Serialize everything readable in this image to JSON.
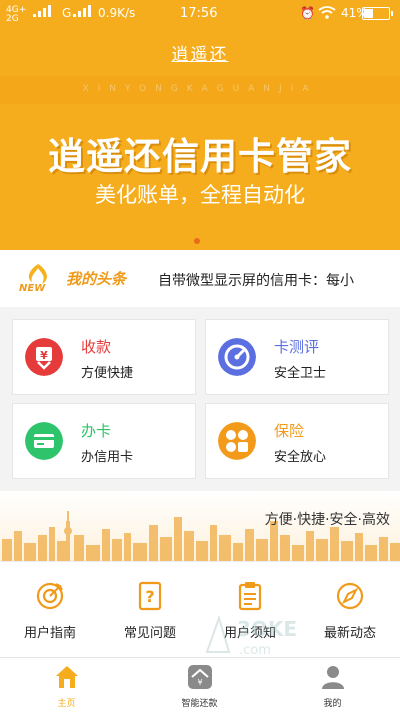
{
  "status_bar": {
    "network_type_top": "4G+",
    "network_type_bottom": "2G",
    "network_label": "G",
    "speed": "0.9K/s",
    "time": "17:56",
    "battery": "41%"
  },
  "header": {
    "title": "逍遥还"
  },
  "banner": {
    "pinyin": "XINYONGKAGUANJIA",
    "headline": "逍遥还信用卡管家",
    "subline": "美化账单，全程自动化"
  },
  "news": {
    "badge": "NEW",
    "tag": "我的头条",
    "ticker": "自带微型显示屏的信用卡：每小"
  },
  "tiles": [
    {
      "title": "收款",
      "desc": "方便快捷",
      "color": "#e53b3b",
      "icon": "yuan-download-icon"
    },
    {
      "title": "卡测评",
      "desc": "安全卫士",
      "color": "#5b6fe0",
      "icon": "gauge-icon"
    },
    {
      "title": "办卡",
      "desc": "办信用卡",
      "color": "#2dc46b",
      "icon": "credit-card-icon"
    },
    {
      "title": "保险",
      "desc": "安全放心",
      "color": "#f39a1b",
      "icon": "insurance-grid-icon"
    }
  ],
  "city_banner": {
    "slogan": "方便·快捷·安全·高效"
  },
  "quick_links": [
    {
      "label": "用户指南",
      "icon": "target-icon"
    },
    {
      "label": "常见问题",
      "icon": "question-doc-icon"
    },
    {
      "label": "用户须知",
      "icon": "clipboard-icon"
    },
    {
      "label": "最新动态",
      "icon": "compass-icon"
    }
  ],
  "tab_bar": {
    "active_color": "#f6ad1d",
    "tabs": [
      {
        "label": "主页",
        "icon": "home-icon"
      },
      {
        "label": "智能还款",
        "icon": "smart-repay-icon"
      },
      {
        "label": "我的",
        "icon": "user-icon"
      }
    ]
  },
  "colors": {
    "brand": "#f6ad1d",
    "accent": "#f09a1a"
  }
}
